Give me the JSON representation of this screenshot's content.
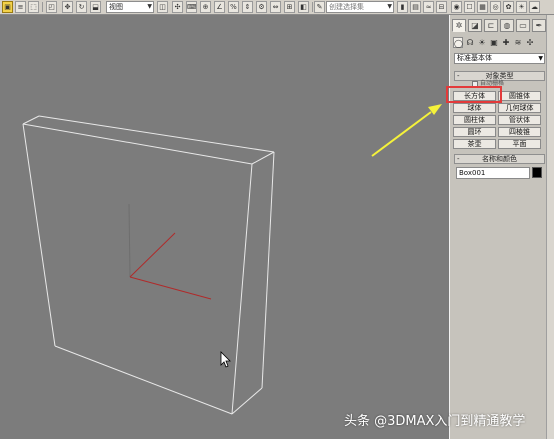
{
  "toolbar": {
    "view_dropdown": "视图",
    "selection_set_placeholder": "创建选择集"
  },
  "panel": {
    "category_dropdown": "标准基本体",
    "object_type_title": "对象类型",
    "auto_grid_label": "自动栅格",
    "buttons": [
      {
        "label": "长方体"
      },
      {
        "label": "圆锥体"
      },
      {
        "label": "球体"
      },
      {
        "label": "几何球体"
      },
      {
        "label": "圆柱体"
      },
      {
        "label": "管状体"
      },
      {
        "label": "圆环"
      },
      {
        "label": "四棱锥"
      },
      {
        "label": "茶壶"
      },
      {
        "label": "平面"
      }
    ],
    "name_color_title": "名称和颜色",
    "name_value": "Box001"
  },
  "colors": {
    "viewport_bg": "#7c7c7c",
    "highlight": "#e33a3a",
    "arrow": "#f5f23a",
    "object_color": "#000000"
  },
  "watermark": "头条 @3DMAX入门到精通教学"
}
